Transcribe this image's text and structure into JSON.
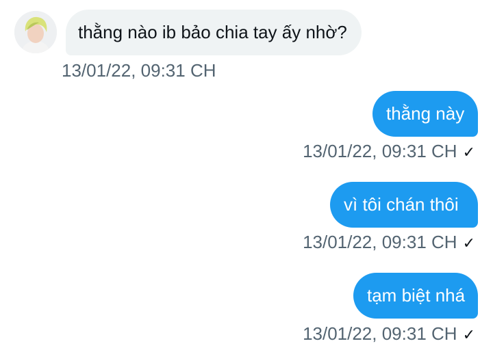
{
  "conversation": {
    "messages": [
      {
        "direction": "incoming",
        "text": "thằng nào ib bảo chia tay ấy nhờ?",
        "time": "13/01/22, 09:31 CH"
      },
      {
        "direction": "outgoing",
        "text": "thằng này",
        "time": "13/01/22, 09:31 CH",
        "status_icon": "checkmark-icon"
      },
      {
        "direction": "outgoing",
        "text": "vì tôi chán thôi",
        "time": "13/01/22, 09:31 CH",
        "status_icon": "checkmark-icon"
      },
      {
        "direction": "outgoing",
        "text": "tạm biệt nhá",
        "time": "13/01/22, 09:31 CH",
        "status_icon": "checkmark-icon"
      }
    ],
    "check_glyph": "✓"
  },
  "colors": {
    "outgoing_bubble": "#1d9bf0",
    "incoming_bubble": "#eff3f4",
    "timestamp": "#536471"
  }
}
